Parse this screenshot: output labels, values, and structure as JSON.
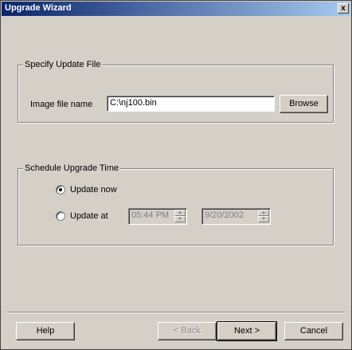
{
  "window": {
    "title": "Upgrade Wizard",
    "close_glyph": "x"
  },
  "update_file": {
    "group_label": "Specify Update File",
    "image_label": "Image file name",
    "image_value": "C:\\nj100.bin",
    "browse_label": "Browse"
  },
  "schedule": {
    "group_label": "Schedule Upgrade Time",
    "update_now_label": "Update now",
    "update_now_selected": true,
    "update_at_label": "Update at",
    "time_value": "05:44 PM",
    "date_value": "9/20/2002"
  },
  "buttons": {
    "help": "Help",
    "back": "< Back",
    "next": "Next >",
    "cancel": "Cancel"
  }
}
